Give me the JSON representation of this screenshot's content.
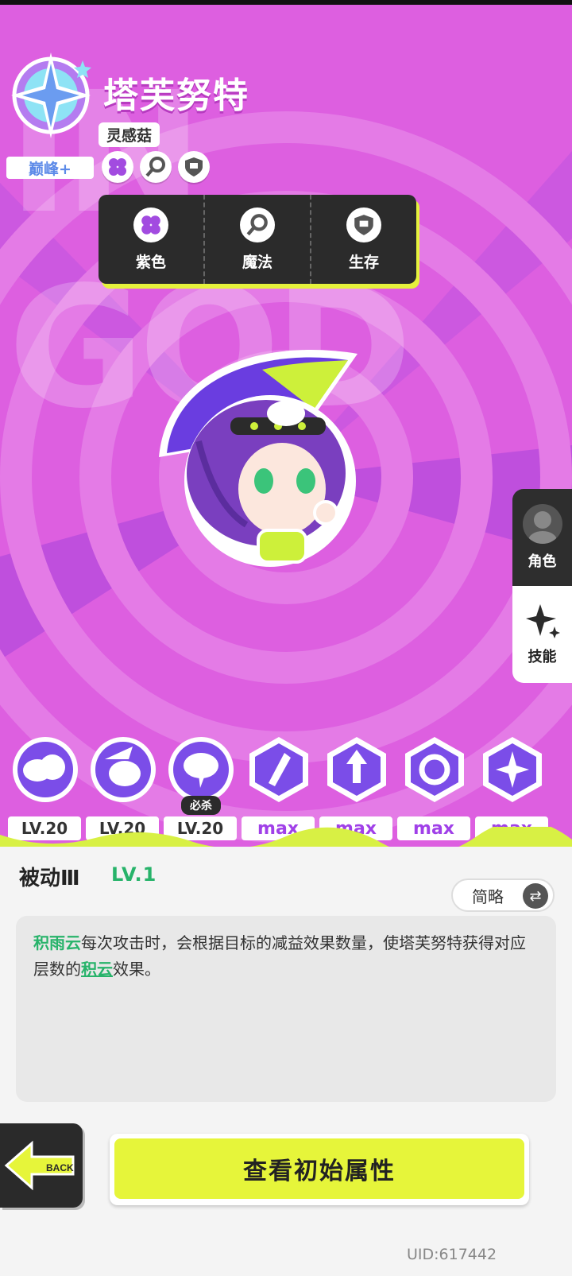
{
  "colors": {
    "background": "#dd5fe0",
    "accent_yellow": "#e6f53a",
    "keyword_green": "#27b36a",
    "max_purple": "#a040e8",
    "dark_panel": "#2b2b2b"
  },
  "character": {
    "name": "塔芙努特",
    "subtitle": "灵感菇",
    "rank": "巅峰+",
    "tag_icons": [
      "purple-clover-icon",
      "magic-wand-icon",
      "shield-icon"
    ]
  },
  "attributes": [
    {
      "label": "紫色",
      "icon": "purple-clover-icon"
    },
    {
      "label": "魔法",
      "icon": "magic-wand-icon"
    },
    {
      "label": "生存",
      "icon": "shield-icon"
    }
  ],
  "side_tabs": {
    "role_label": "角色",
    "skill_label": "技能"
  },
  "skills": [
    {
      "level": "LV.20",
      "icon": "cloud-punch-icon"
    },
    {
      "level": "LV.20",
      "icon": "cloud-face-icon"
    },
    {
      "level": "LV.20",
      "icon": "storm-cloud-icon",
      "tag": "必杀"
    },
    {
      "level": "max",
      "icon": "slash-burst-icon"
    },
    {
      "level": "max",
      "icon": "arrow-up-icon"
    },
    {
      "level": "max",
      "icon": "swirl-icon"
    },
    {
      "level": "max",
      "icon": "star-orbit-icon"
    }
  ],
  "detail": {
    "title": "被动Ⅲ",
    "level": "LV.1",
    "mode_label": "简略",
    "desc_kw1": "积雨云",
    "desc_part1": "每次攻击时，会根据目标的减益效果数量，使塔芙努特获得对应层数的",
    "desc_kw2": "积云",
    "desc_part2": "效果。"
  },
  "buttons": {
    "back_label": "BACK",
    "main_label": "查看初始属性"
  },
  "uid": "UID:617442"
}
